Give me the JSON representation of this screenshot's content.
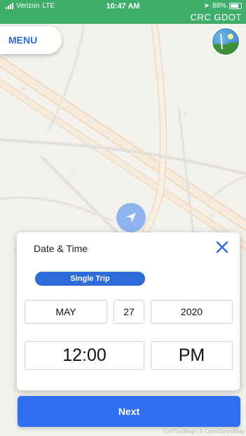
{
  "status_bar": {
    "carrier": "Verizon",
    "network": "LTE",
    "time": "10:47 AM",
    "battery": "88%",
    "battery_level": 0.88,
    "org_label": "CRC GDOT"
  },
  "header": {
    "menu_label": "MENU",
    "logo_icon": "agency-logo-icon"
  },
  "map": {
    "attribution": "GetYourMap | © OpenStreetMap"
  },
  "dialog": {
    "title": "Date & Time",
    "trip_type": "Single Trip",
    "date": {
      "month": "MAY",
      "day": "27",
      "year": "2020"
    },
    "time": {
      "value": "12:00",
      "period": "PM"
    }
  },
  "footer": {
    "next_label": "Next"
  },
  "colors": {
    "status_green": "#3fae6a",
    "accent_blue": "#2d6bd8",
    "next_blue": "#2f6ff0"
  }
}
